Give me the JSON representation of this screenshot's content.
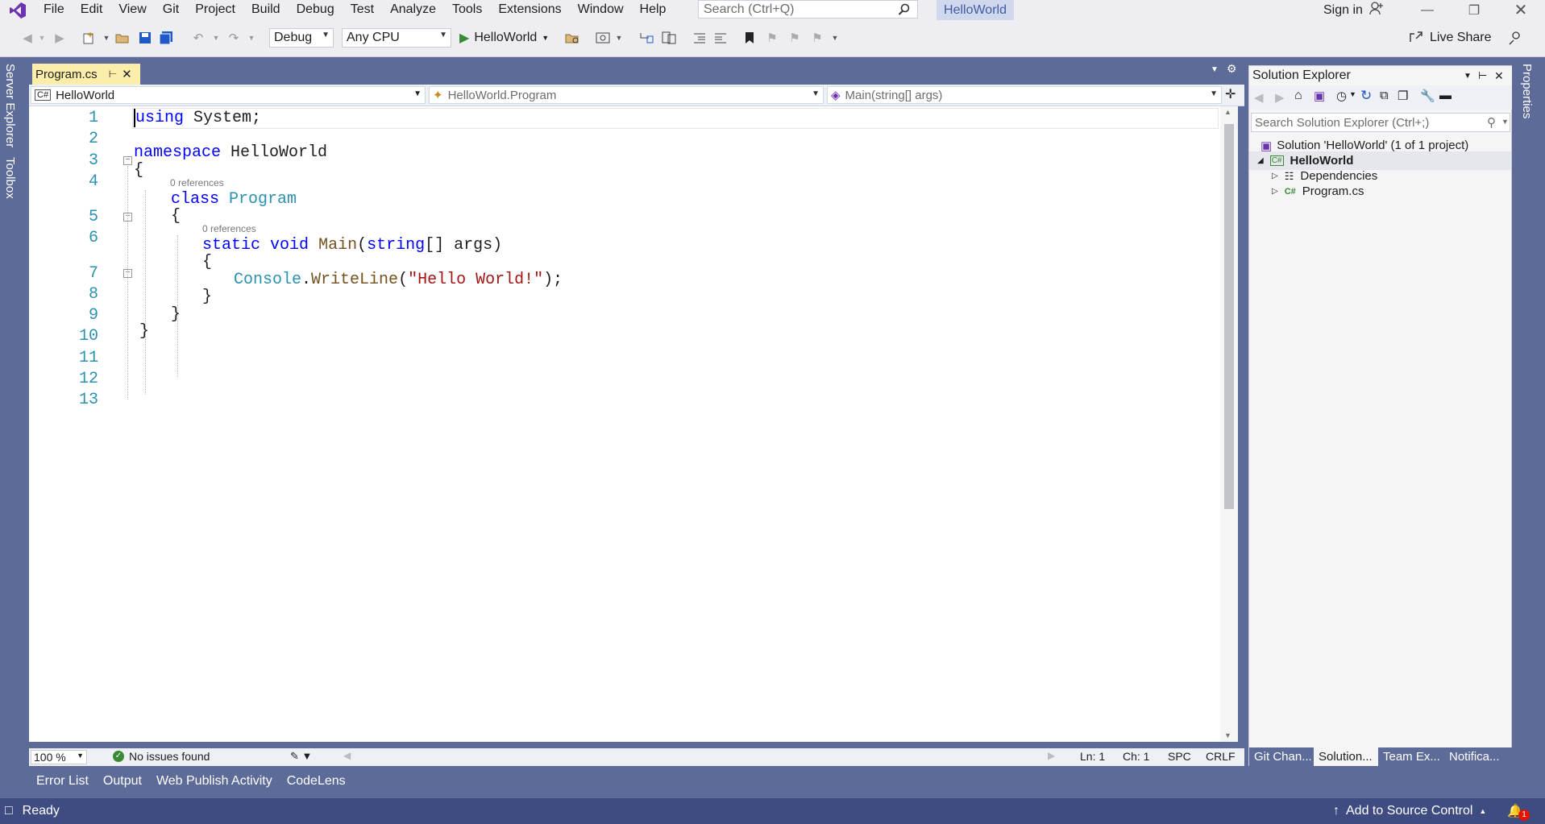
{
  "menubar": {
    "items": [
      "File",
      "Edit",
      "View",
      "Git",
      "Project",
      "Build",
      "Debug",
      "Test",
      "Analyze",
      "Tools",
      "Extensions",
      "Window",
      "Help"
    ],
    "search_placeholder": "Search (Ctrl+Q)",
    "solution_name": "HelloWorld",
    "signin_label": "Sign in"
  },
  "toolbar": {
    "configuration": "Debug",
    "platform": "Any CPU",
    "run_target": "HelloWorld",
    "live_share": "Live Share"
  },
  "left_rail": {
    "tabs": [
      "Server Explorer",
      "Toolbox"
    ]
  },
  "right_rail": {
    "tabs": [
      "Properties"
    ]
  },
  "editor": {
    "tab_title": "Program.cs",
    "nav_project": "HelloWorld",
    "nav_type": "HelloWorld.Program",
    "nav_member": "Main(string[] args)",
    "line_numbers": [
      "1",
      "2",
      "3",
      "4",
      "5",
      "6",
      "7",
      "8",
      "9",
      "10",
      "11",
      "12",
      "13"
    ],
    "codelens": "0 references",
    "code": {
      "l1_kw": "using",
      "l1_rest": " System;",
      "l3_kw": "namespace",
      "l3_rest": " HelloWorld",
      "brace_open": "{",
      "brace_close": "}",
      "l5_kw": "class",
      "l5_type": "Program",
      "l7_kw1": "static",
      "l7_kw2": "void",
      "l7_fn": "Main",
      "l7_paren": "(",
      "l7_kw3": "string",
      "l7_rest": "[] args)",
      "l9_type": "Console",
      "l9_dot": ".",
      "l9_fn": "WriteLine",
      "l9_paren": "(",
      "l9_str": "\"Hello World!\"",
      "l9_end": ");"
    },
    "zoom": "100 %",
    "issues": "No issues found",
    "line": "Ln: 1",
    "char": "Ch: 1",
    "spc": "SPC",
    "eol": "CRLF"
  },
  "solution_explorer": {
    "title": "Solution Explorer",
    "search_placeholder": "Search Solution Explorer (Ctrl+;)",
    "solution_label": "Solution 'HelloWorld' (1 of 1 project)",
    "project": "HelloWorld",
    "items": [
      "Dependencies",
      "Program.cs"
    ],
    "bottom_tabs": [
      "Git Chan...",
      "Solution...",
      "Team Ex...",
      "Notifica..."
    ]
  },
  "tool_tabs": [
    "Error List",
    "Output",
    "Web Publish Activity",
    "CodeLens"
  ],
  "status": {
    "ready": "Ready",
    "source_control": "Add to Source Control",
    "notification_count": "1"
  },
  "colors": {
    "frame": "#5d6b99",
    "keyword": "#0000ff",
    "type": "#2b91af",
    "string": "#a31515",
    "active_tab": "#fcedaa",
    "run_green": "#388a34"
  }
}
